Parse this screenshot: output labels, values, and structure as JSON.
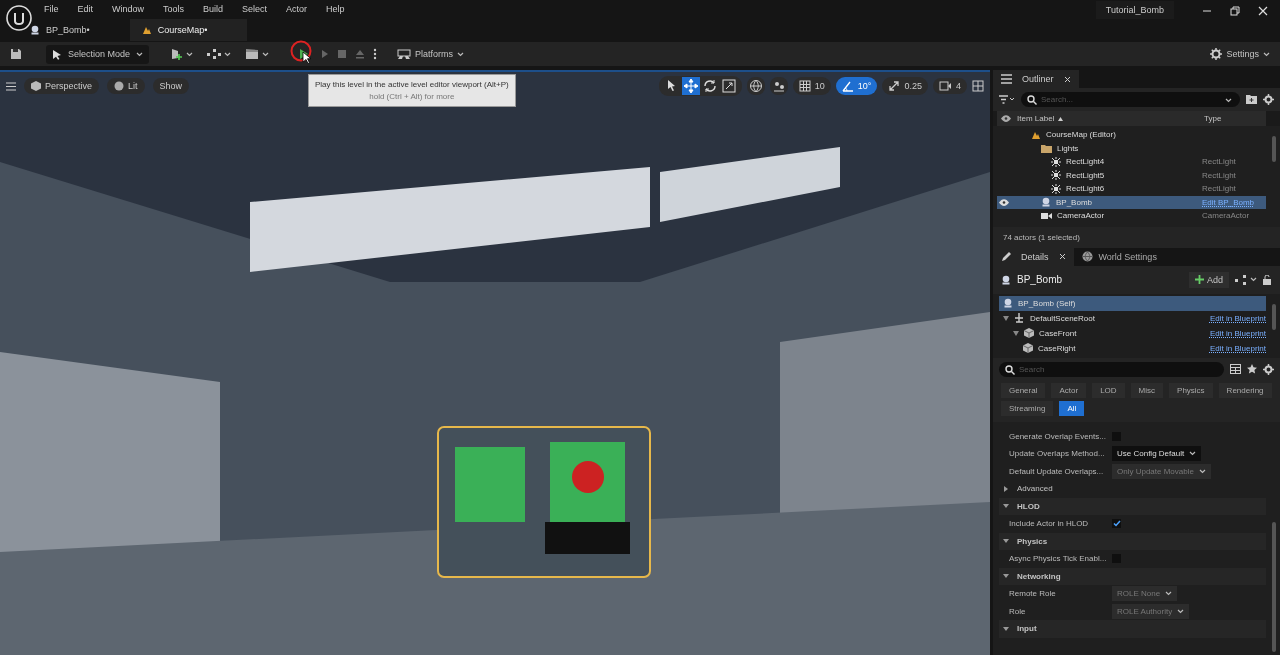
{
  "menu": [
    "File",
    "Edit",
    "Window",
    "Tools",
    "Build",
    "Select",
    "Actor",
    "Help"
  ],
  "doc_tabs": [
    {
      "label": "BP_Bomb•",
      "kind": "blueprint",
      "selected": false
    },
    {
      "label": "CourseMap•",
      "kind": "level",
      "selected": true
    }
  ],
  "window_title": "Tutorial_Bomb",
  "toolbar": {
    "mode": "Selection Mode",
    "platforms": "Platforms",
    "settings": "Settings",
    "play_highlighted": true
  },
  "tooltip": {
    "text": "Play this level in the active level editor viewport (Alt+P)",
    "hint": "hold (Ctrl + Alt) for more"
  },
  "viewport": {
    "buttons": [
      {
        "label": "Perspective",
        "kind": "camera"
      },
      {
        "label": "Lit",
        "kind": "lit"
      },
      {
        "label": "Show",
        "kind": "plain"
      }
    ],
    "tools": [
      {
        "kind": "select",
        "selected": false
      },
      {
        "kind": "translate",
        "selected": true
      },
      {
        "kind": "rotate",
        "selected": false
      },
      {
        "kind": "scale",
        "selected": false
      }
    ],
    "snaps": [
      {
        "kind": "grid",
        "value": "10",
        "on": false
      },
      {
        "kind": "angle",
        "value": "10°",
        "on": true
      },
      {
        "kind": "scale",
        "value": "0.25",
        "on": false
      },
      {
        "kind": "camera",
        "value": "4",
        "on": false
      }
    ]
  },
  "outliner": {
    "title": "Outliner",
    "search": {
      "placeholder": "Search..."
    },
    "columns": [
      "Item Label",
      "Type"
    ],
    "rows": [
      {
        "label": "CourseMap (Editor)",
        "kind": "level",
        "selected": false,
        "children": [
          {
            "label": "Lights",
            "kind": "folder",
            "selected": false,
            "children": [
              {
                "label": "RectLight4",
                "kind": "light",
                "type": "RectLight",
                "selected": false
              },
              {
                "label": "RectLight5",
                "kind": "light",
                "type": "RectLight",
                "selected": false
              },
              {
                "label": "RectLight6",
                "kind": "light",
                "type": "RectLight",
                "selected": false
              }
            ]
          },
          {
            "label": "BP_Bomb",
            "kind": "blueprint",
            "type": "Edit BP_Bomb",
            "type_link": true,
            "selected": true
          },
          {
            "label": "CameraActor",
            "kind": "camera",
            "type": "CameraActor",
            "selected": false
          }
        ]
      }
    ],
    "footer": "74 actors (1 selected)"
  },
  "details": {
    "tabs": [
      {
        "label": "Details",
        "kind": "details",
        "selected": true
      },
      {
        "label": "World Settings",
        "kind": "world",
        "selected": false
      }
    ],
    "actor": "BP_Bomb",
    "add": "Add",
    "components": [
      {
        "label": "BP_Bomb (Self)",
        "kind": "self",
        "selected": true
      },
      {
        "label": "DefaultSceneRoot",
        "kind": "root",
        "selected": false,
        "link": "Edit in Blueprint",
        "children": [
          {
            "label": "CaseFront",
            "kind": "mesh",
            "selected": false,
            "link": "Edit in Blueprint",
            "children": [
              {
                "label": "CaseRight",
                "kind": "mesh",
                "selected": false,
                "link": "Edit in Blueprint"
              }
            ]
          }
        ]
      }
    ],
    "search": {
      "placeholder": "Search"
    },
    "filters": [
      {
        "label": "General",
        "selected": false
      },
      {
        "label": "Actor",
        "selected": false
      },
      {
        "label": "LOD",
        "selected": false
      },
      {
        "label": "Misc",
        "selected": false
      },
      {
        "label": "Physics",
        "selected": false
      },
      {
        "label": "Rendering",
        "selected": false
      },
      {
        "label": "Streaming",
        "selected": false
      },
      {
        "label": "All",
        "selected": true
      }
    ],
    "properties": [
      {
        "kind": "checkbox",
        "label": "Generate Overlap Events...",
        "checked": false
      },
      {
        "kind": "dropdown",
        "label": "Update Overlaps Method...",
        "value": "Use Config Default",
        "disabled": false
      },
      {
        "kind": "dropdown",
        "label": "Default Update Overlaps...",
        "value": "Only Update Movable",
        "disabled": true
      },
      {
        "kind": "subgroup",
        "label": "Advanced",
        "expanded": false
      },
      {
        "kind": "section",
        "label": "HLOD",
        "expanded": true
      },
      {
        "kind": "checkbox",
        "label": "Include Actor in HLOD",
        "checked": true
      },
      {
        "kind": "section",
        "label": "Physics",
        "expanded": true
      },
      {
        "kind": "checkbox",
        "label": "Async Physics Tick Enabl...",
        "checked": false
      },
      {
        "kind": "section",
        "label": "Networking",
        "expanded": true
      },
      {
        "kind": "dropdown",
        "label": "Remote Role",
        "value": "ROLE None",
        "disabled": true
      },
      {
        "kind": "dropdown",
        "label": "Role",
        "value": "ROLE Authority",
        "disabled": true
      },
      {
        "kind": "section",
        "label": "Input",
        "expanded": true
      }
    ]
  }
}
